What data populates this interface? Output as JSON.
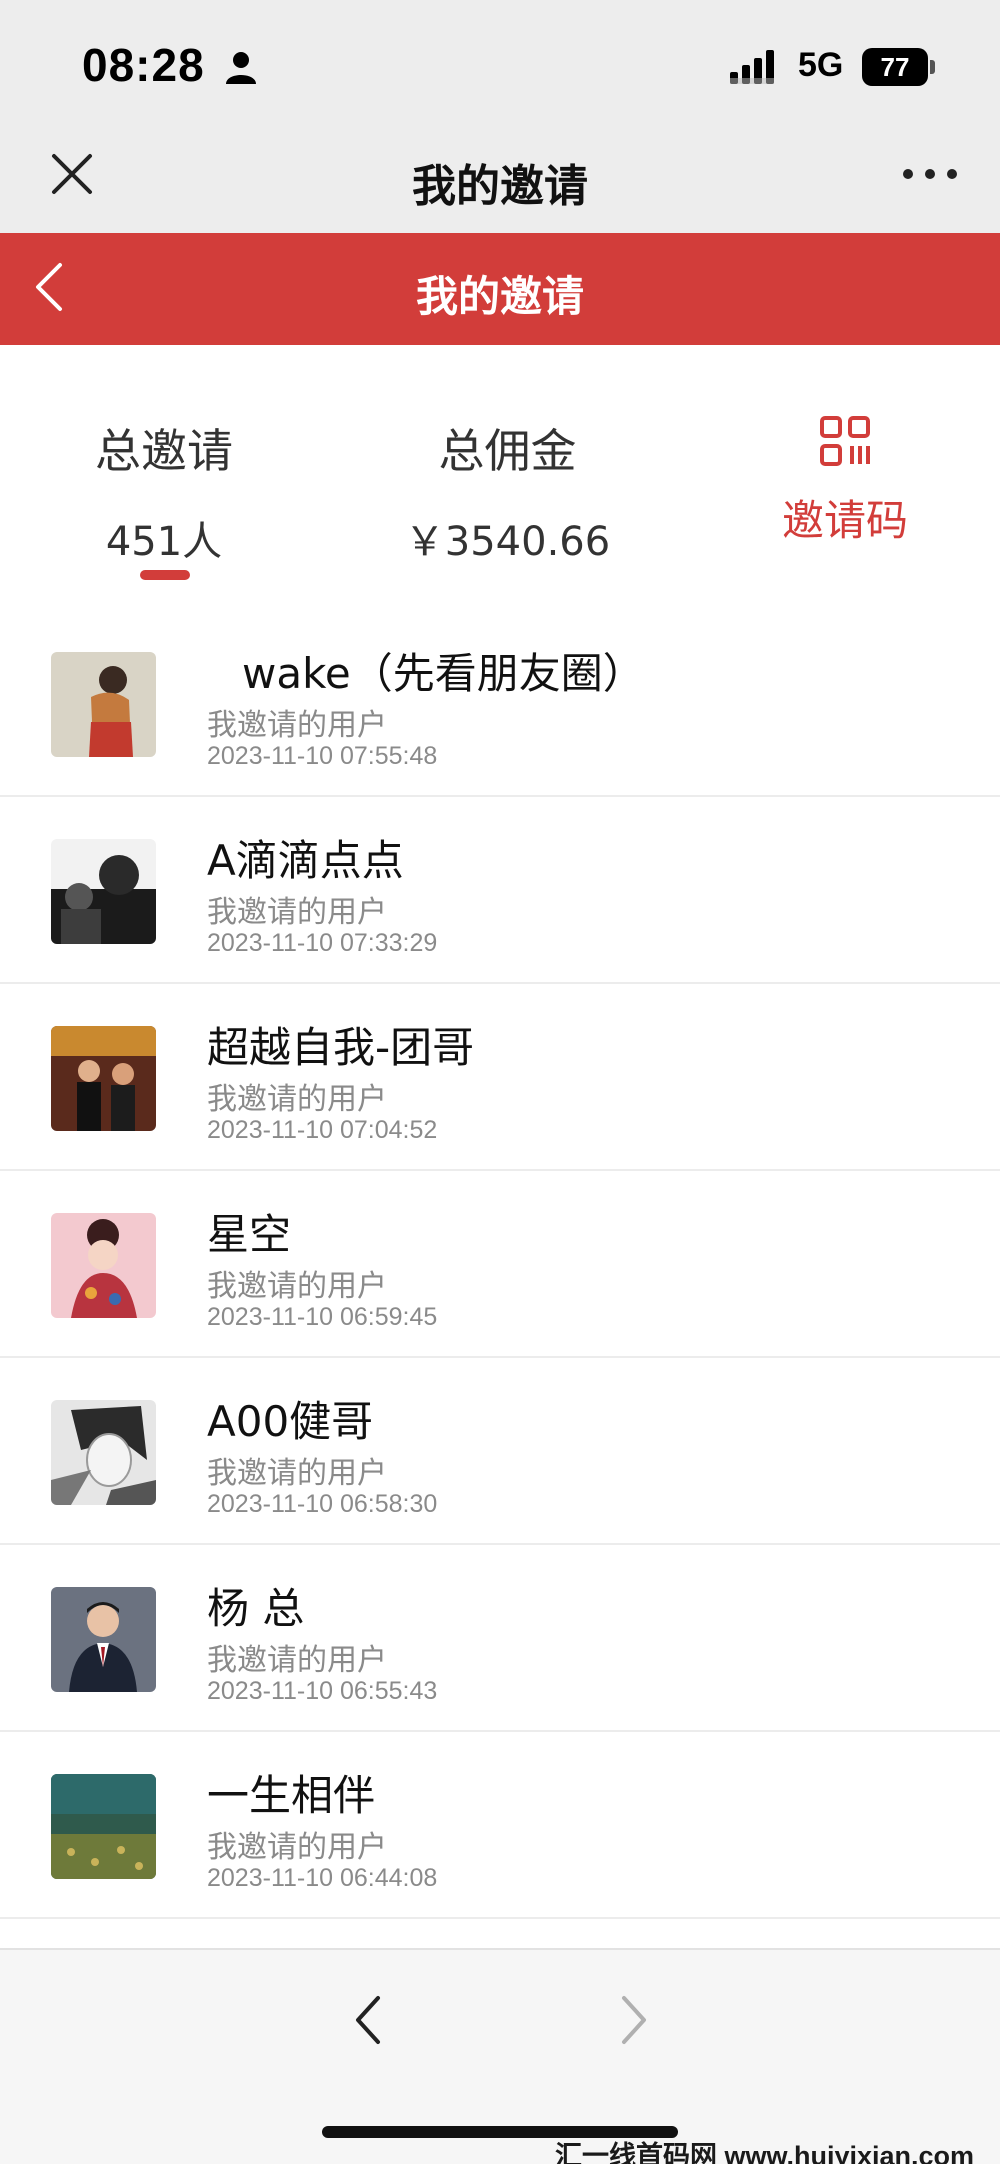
{
  "status_bar": {
    "time": "08:28",
    "network": "5G",
    "battery": "77"
  },
  "wechat_nav": {
    "title": "我的邀请"
  },
  "header": {
    "title": "我的邀请"
  },
  "summary": {
    "invites_label": "总邀请",
    "invites_value": "451人",
    "commission_label": "总佣金",
    "commission_value": "￥3540.66",
    "invite_code_label": "邀请码"
  },
  "colors": {
    "accent": "#d23d3a",
    "nav_bg": "#ededed"
  },
  "invites": [
    {
      "name": "wake（先看朋友圈）",
      "relation": "我邀请的用户",
      "time": "2023-11-10 07:55:48"
    },
    {
      "name": "A滴滴点点",
      "relation": "我邀请的用户",
      "time": "2023-11-10 07:33:29"
    },
    {
      "name": "超越自我-团哥",
      "relation": "我邀请的用户",
      "time": "2023-11-10 07:04:52"
    },
    {
      "name": "星空",
      "relation": "我邀请的用户",
      "time": "2023-11-10 06:59:45"
    },
    {
      "name": "A00健哥",
      "relation": "我邀请的用户",
      "time": "2023-11-10 06:58:30"
    },
    {
      "name": "杨 总",
      "relation": "我邀请的用户",
      "time": "2023-11-10 06:55:43"
    },
    {
      "name": "一生相伴",
      "relation": "我邀请的用户",
      "time": "2023-11-10 06:44:08"
    }
  ],
  "watermark": "汇一线首码网 www.huiyixian.com"
}
